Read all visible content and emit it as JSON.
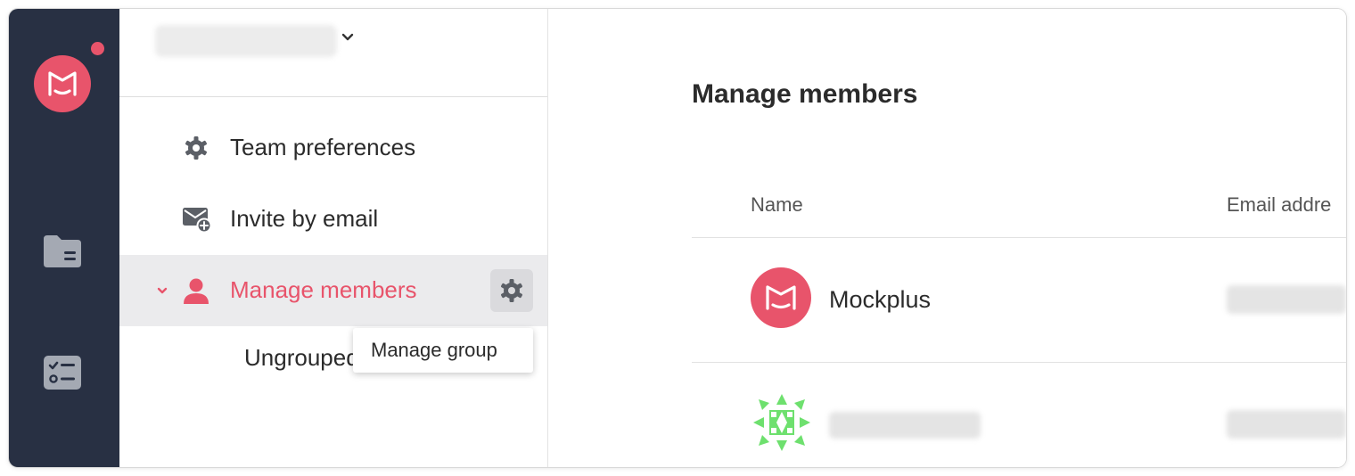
{
  "sidebar_rail": {
    "logo_icon": "mockplus-logo-icon",
    "notification": true,
    "icons": [
      "folder-icon",
      "task-list-icon"
    ]
  },
  "team_menu": {
    "items": [
      {
        "label": "Team preferences",
        "icon": "gear-icon"
      },
      {
        "label": "Invite by email",
        "icon": "mail-plus-icon"
      },
      {
        "label": "Manage members",
        "icon": "user-icon",
        "active": true
      }
    ],
    "sub_items": [
      {
        "label": "Ungrouped"
      }
    ],
    "tooltip": "Manage group"
  },
  "main": {
    "title": "Manage members",
    "columns": [
      "Name",
      "Email addre"
    ],
    "members": [
      {
        "name": "Mockplus"
      }
    ]
  },
  "colors": {
    "accent": "#e8546b",
    "rail_bg": "#283043",
    "active_row_bg": "#ebebed",
    "identicon_green": "#6ee06e"
  }
}
